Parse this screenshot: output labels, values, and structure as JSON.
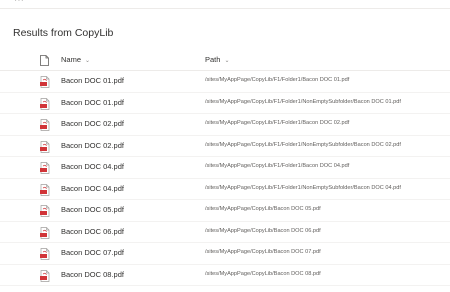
{
  "colors": {
    "pdf_red": "#d13438",
    "text": "#323130",
    "muted": "#605e5c",
    "divider": "#edebe9"
  },
  "header": {
    "title": "Results from CopyLib"
  },
  "columns": {
    "type_icon": "document-icon",
    "name": "Name",
    "path": "Path"
  },
  "rows": [
    {
      "name": "Bacon DOC 01.pdf",
      "path": "/sites/MyAppPage/CopyLib/F1/Folder1/Bacon DOC 01.pdf"
    },
    {
      "name": "Bacon DOC 01.pdf",
      "path": "/sites/MyAppPage/CopyLib/F1/Folder1/NonEmptySubfolder/Bacon DOC 01.pdf"
    },
    {
      "name": "Bacon DOC 02.pdf",
      "path": "/sites/MyAppPage/CopyLib/F1/Folder1/Bacon DOC 02.pdf"
    },
    {
      "name": "Bacon DOC 02.pdf",
      "path": "/sites/MyAppPage/CopyLib/F1/Folder1/NonEmptySubfolder/Bacon DOC 02.pdf"
    },
    {
      "name": "Bacon DOC 04.pdf",
      "path": "/sites/MyAppPage/CopyLib/F1/Folder1/Bacon DOC 04.pdf"
    },
    {
      "name": "Bacon DOC 04.pdf",
      "path": "/sites/MyAppPage/CopyLib/F1/Folder1/NonEmptySubfolder/Bacon DOC 04.pdf"
    },
    {
      "name": "Bacon DOC 05.pdf",
      "path": "/sites/MyAppPage/CopyLib/Bacon DOC 05.pdf"
    },
    {
      "name": "Bacon DOC 06.pdf",
      "path": "/sites/MyAppPage/CopyLib/Bacon DOC 06.pdf"
    },
    {
      "name": "Bacon DOC 07.pdf",
      "path": "/sites/MyAppPage/CopyLib/Bacon DOC 07.pdf"
    },
    {
      "name": "Bacon DOC 08.pdf",
      "path": "/sites/MyAppPage/CopyLib/Bacon DOC 08.pdf"
    }
  ]
}
